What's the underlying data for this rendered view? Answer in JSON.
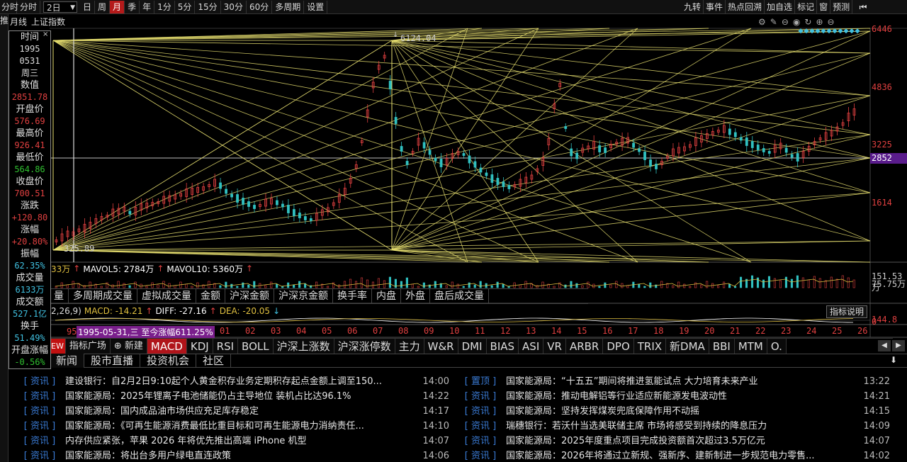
{
  "toolbar": {
    "left_tab": "分时",
    "period_select": "2日",
    "periods": [
      "日",
      "周",
      "月",
      "季",
      "年",
      "1分",
      "5分",
      "15分",
      "30分",
      "60分",
      "多周期",
      "设置"
    ],
    "active_period": "月",
    "right_buttons": [
      "九转",
      "事件",
      "热点回溯",
      "加自选",
      "标记",
      "窗",
      "预测"
    ]
  },
  "chart_header": {
    "period": "月线",
    "index_name": "上证指数"
  },
  "info_panel": {
    "fields": [
      {
        "label": "时间",
        "values": [
          "1995",
          "0531",
          "周三"
        ]
      },
      {
        "label": "数值",
        "values": [
          "2851.78"
        ],
        "color": "#e04040"
      },
      {
        "label": "开盘价",
        "values": [
          "576.69"
        ],
        "color": "#e04040"
      },
      {
        "label": "最高价",
        "values": [
          "926.41"
        ],
        "color": "#e04040"
      },
      {
        "label": "最低价",
        "values": [
          "564.86"
        ],
        "color": "#30c030"
      },
      {
        "label": "收盘价",
        "values": [
          "700.51"
        ],
        "color": "#e04040"
      },
      {
        "label": "涨跌",
        "values": [
          "+120.80"
        ],
        "color": "#e04040"
      },
      {
        "label": "涨幅",
        "values": [
          "+20.80%"
        ],
        "color": "#e04040"
      },
      {
        "label": "振幅",
        "values": [
          "62.35%"
        ],
        "color": "#40c0e0"
      },
      {
        "label": "成交量",
        "values": [
          "6133万"
        ],
        "color": "#40c0e0"
      },
      {
        "label": "成交额",
        "values": [
          "527.1亿"
        ],
        "color": "#40c0e0"
      },
      {
        "label": "换手",
        "values": [
          "51.49%"
        ],
        "color": "#40c0e0"
      },
      {
        "label": "开盘涨幅",
        "values": [
          "-0.56%"
        ],
        "color": "#30c030"
      }
    ]
  },
  "price_chart": {
    "y_ticks": [
      "6446",
      "4836",
      "3225",
      "1614"
    ],
    "current_price": "2852",
    "peak_label": "6124.04",
    "low_label": "325.89"
  },
  "volume": {
    "vol_prefix": "33万",
    "mavol5": "MAVOL5: 2784万",
    "mavol10": "MAVOL10: 5360万",
    "y_ticks": [
      "151.53万",
      "75.75万"
    ]
  },
  "indicator_tabs": [
    "量",
    "多周期成交量",
    "虚拟成交量",
    "金额",
    "沪深金额",
    "沪深京金额",
    "换手率",
    "内盘",
    "外盘",
    "盘后成交量"
  ],
  "macd": {
    "params": "2,26,9)",
    "macd": "MACD: -14.21",
    "diff": "DIFF: -27.16",
    "dea": "DEA: -20.05",
    "explain_btn": "指标说明",
    "y_ticks": [
      "144.8",
      "0"
    ]
  },
  "time_axis": {
    "range_label": "1995-05-31,三 至今涨幅611.25%",
    "first": "95",
    "labels": [
      "01",
      "02",
      "03",
      "04",
      "05",
      "06",
      "07",
      "08",
      "09",
      "10",
      "11",
      "12",
      "13",
      "14",
      "15",
      "16",
      "17",
      "18",
      "19",
      "20",
      "21",
      "22",
      "23",
      "24",
      "25",
      "26"
    ]
  },
  "bottom_tabs": {
    "new_badge": "EW",
    "square": "指标广场",
    "create": "新建",
    "items": [
      "MACD",
      "KDJ",
      "RSI",
      "BOLL",
      "沪深上涨数",
      "沪深涨停数",
      "主力",
      "W&R",
      "DMI",
      "BIAS",
      "ASI",
      "VR",
      "ARBR",
      "DPO",
      "TRIX",
      "新DMA",
      "BBI",
      "MTM",
      "O."
    ],
    "active": "MACD"
  },
  "news_tabs": [
    "新闻",
    "股市直播",
    "投资机会",
    "社区"
  ],
  "news_left": [
    {
      "tag": "[ 资讯 ]",
      "title": "建设银行：自2月2日9:10起个人黄金积存业务定期积存起点金额上调至150...",
      "time": "14:00"
    },
    {
      "tag": "[ 资讯 ]",
      "title": "国家能源局：2025年锂离子电池储能仍占主导地位 装机占比达96.1%",
      "time": "14:22"
    },
    {
      "tag": "[ 资讯 ]",
      "title": "国家能源局：国内成品油市场供应充足库存稳定",
      "time": "14:17"
    },
    {
      "tag": "[ 资讯 ]",
      "title": "国家能源局：《可再生能源消费最低比重目标和可再生能源电力消纳责任...",
      "time": "14:10"
    },
    {
      "tag": "[ 资讯 ]",
      "title": "内存供应紧张，苹果 2026 年将优先推出高端 iPhone 机型",
      "time": "14:07"
    },
    {
      "tag": "[ 资讯 ]",
      "title": "国家能源局：将出台多用户绿电直连政策",
      "time": "14:06"
    }
  ],
  "news_right": [
    {
      "tag": "[ 置顶 ]",
      "title": "国家能源局：“十五五”期间将推进氢能试点 大力培育未来产业",
      "time": "13:22"
    },
    {
      "tag": "[ 资讯 ]",
      "title": "国家能源局：推动电解铝等行业适应新能源发电波动性",
      "time": "14:21"
    },
    {
      "tag": "[ 资讯 ]",
      "title": "国家能源局：坚持发挥煤炭兜底保障作用不动摇",
      "time": "14:15"
    },
    {
      "tag": "[ 资讯 ]",
      "title": "瑞穗银行：若沃什当选美联储主席 市场将感受到持续的降息压力",
      "time": "14:09"
    },
    {
      "tag": "[ 资讯 ]",
      "title": "国家能源局：2025年度重点项目完成投资额首次超过3.5万亿元",
      "time": "14:07"
    },
    {
      "tag": "[ 资讯 ]",
      "title": "国家能源局：2026年将通过立新规、强新序、建新制进一步规范电力零售...",
      "time": "14:02"
    }
  ],
  "left_strip": [
    "推",
    "荐"
  ],
  "colors": {
    "up": "#e04040",
    "down": "#30c0c0",
    "gann": "#e8e070",
    "accent": "#b41a1a",
    "link": "#3a7bd5"
  }
}
